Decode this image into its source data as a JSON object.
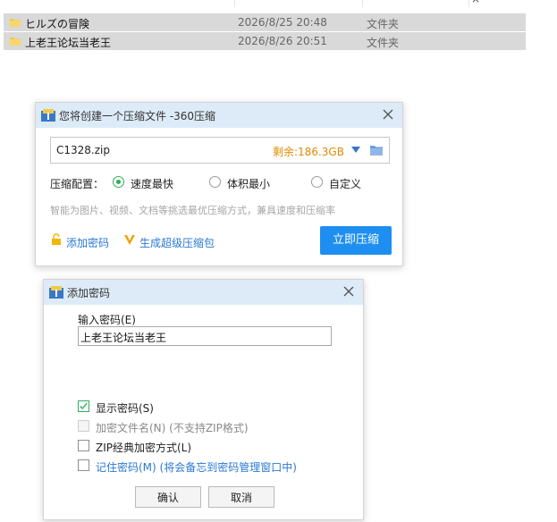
{
  "file_list": {
    "header_partial": [
      "",
      "",
      "×"
    ],
    "rows": [
      {
        "name": "ヒルズの冒険",
        "date": "2026/8/25 20:48",
        "type": "文件夹"
      },
      {
        "name": "上老王论坛当老王",
        "date": "2026/8/26 20:51",
        "type": "文件夹"
      }
    ]
  },
  "compress_dialog": {
    "title": "您将创建一个压缩文件 -360压缩",
    "filename": "C1328.zip",
    "free_space": "剩余:186.3GB",
    "config_label": "压缩配置：",
    "options": [
      "速度最快",
      "体积最小",
      "自定义"
    ],
    "selected_option": "速度最快",
    "hint": "智能为图片、视频、文档等挑选最优压缩方式，兼具速度和压缩率",
    "add_password": "添加密码",
    "super_pack": "生成超级压缩包",
    "compress_now": "立即压缩",
    "accent_color": "#1e8ff0",
    "space_color": "#e08a00"
  },
  "password_dialog": {
    "title": "添加密码",
    "input_label": "输入密码(E)",
    "password_value": "上老王论坛当老王",
    "show_password": "显示密码(S)",
    "show_password_checked": true,
    "encrypt_filenames": "加密文件名(N) (不支持ZIP格式)",
    "encrypt_filenames_enabled": false,
    "zip_classic": "ZIP经典加密方式(L)",
    "remember_password": "记住密码(M) (将会备忘到密码管理窗口中)",
    "ok": "确认",
    "cancel": "取消"
  }
}
